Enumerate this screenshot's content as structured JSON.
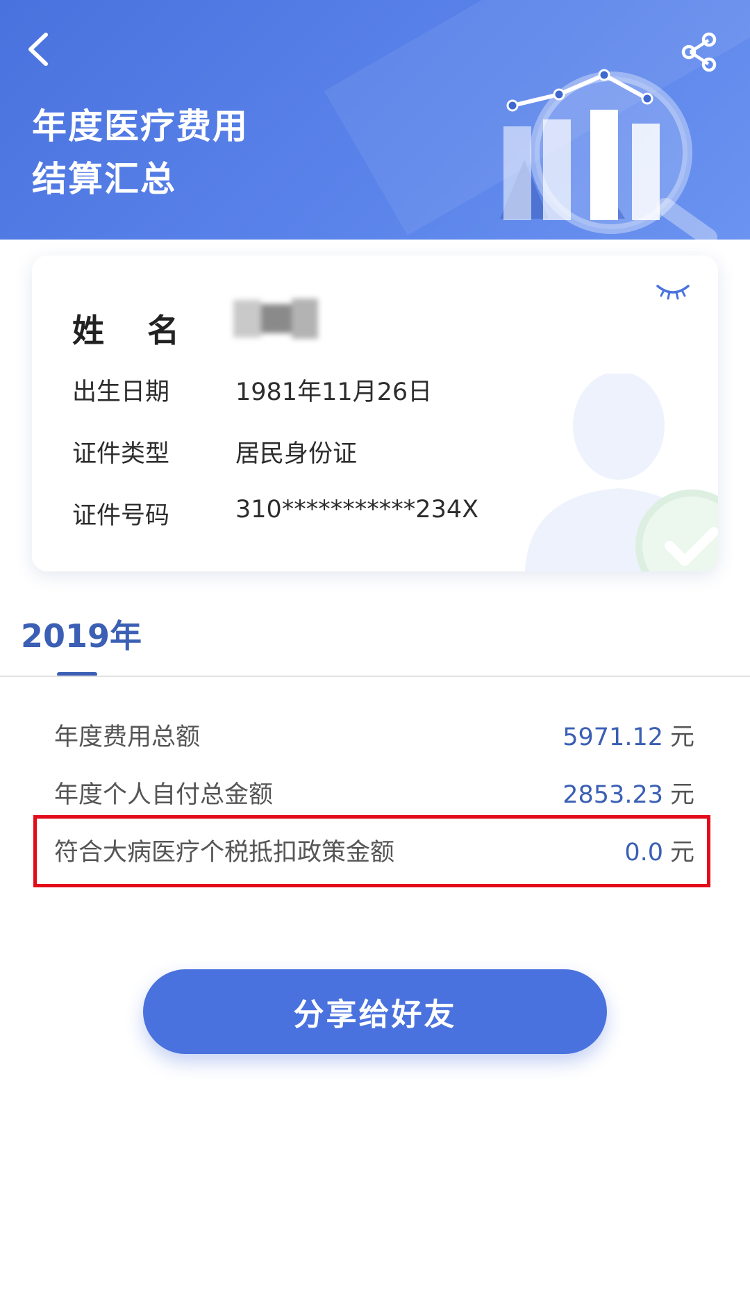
{
  "header": {
    "title_line1": "年度医疗费用",
    "title_line2": "结算汇总",
    "back_icon": "chevron-left-icon",
    "share_icon": "share-icon",
    "background_color": "#4a72de"
  },
  "profile": {
    "name_label": "姓名",
    "name_value_hidden": true,
    "rows": [
      {
        "label": "出生日期",
        "value": "1981年11月26日"
      },
      {
        "label": "证件类型",
        "value": "居民身份证"
      },
      {
        "label": "证件号码",
        "value": "310***********234X"
      }
    ],
    "visibility_icon": "eye-closed-icon"
  },
  "year_tabs": [
    {
      "label": "2019年",
      "selected": true
    }
  ],
  "summary": [
    {
      "label": "年度费用总额",
      "value": "5971.12",
      "unit": "元"
    },
    {
      "label": "年度个人自付总金额",
      "value": "2853.23",
      "unit": "元"
    },
    {
      "label": "符合大病医疗个税抵扣政策金额",
      "value": "0.0",
      "unit": "元",
      "highlighted": true
    }
  ],
  "share_button": {
    "label": "分享给好友"
  },
  "colors": {
    "accent": "#4a72de",
    "value_text": "#3a5fb4",
    "highlight_border": "#e30b1a"
  }
}
